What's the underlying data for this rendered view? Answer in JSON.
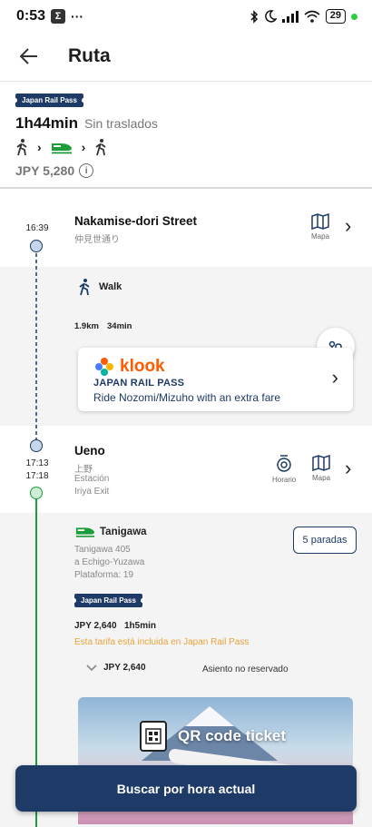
{
  "status_bar": {
    "time": "0:53",
    "badge": "Σ",
    "dots": "···",
    "battery": "29"
  },
  "header": {
    "title": "Ruta"
  },
  "summary": {
    "pass_badge": "Japan Rail Pass",
    "duration": "1h44min",
    "transfers": "Sin traslados",
    "price": "JPY 5,280"
  },
  "stops": [
    {
      "time": "16:39",
      "name": "Nakamise-dori Street",
      "sub": "仲見世通り",
      "map_label": "Mapa"
    },
    {
      "time_arr": "17:13",
      "time_dep": "17:18",
      "name": "Ueno",
      "sub1": "上野",
      "sub2": "Estación",
      "sub3": "Iriya Exit",
      "timetable_label": "Horario",
      "map_label": "Mapa"
    }
  ],
  "walk": {
    "label": "Walk",
    "distance": "1.9km",
    "duration": "34min"
  },
  "klook": {
    "brand": "klook",
    "title": "JAPAN RAIL PASS",
    "desc": "Ride Nozomi/Mizuho with an extra fare"
  },
  "train": {
    "name": "Tanigawa",
    "line1": "Tanigawa 405",
    "line2": "a Echigo-Yuzawa",
    "line3": "Plataforma: 19",
    "stops_button": "5 paradas",
    "pass_badge": "Japan Rail Pass",
    "price": "JPY 2,640",
    "duration": "1h5min",
    "note": "Esta tarifa está incluida en Japan Rail Pass",
    "fare_price": "JPY 2,640",
    "seat": "Asiento no reservado"
  },
  "banner": {
    "text": "QR code ticket"
  },
  "bottom_button": {
    "label": "Buscar por hora actual"
  },
  "colors": {
    "primary": "#1e3a66",
    "accent_orange": "#e8a33a",
    "train_green": "#1b9e3a"
  }
}
